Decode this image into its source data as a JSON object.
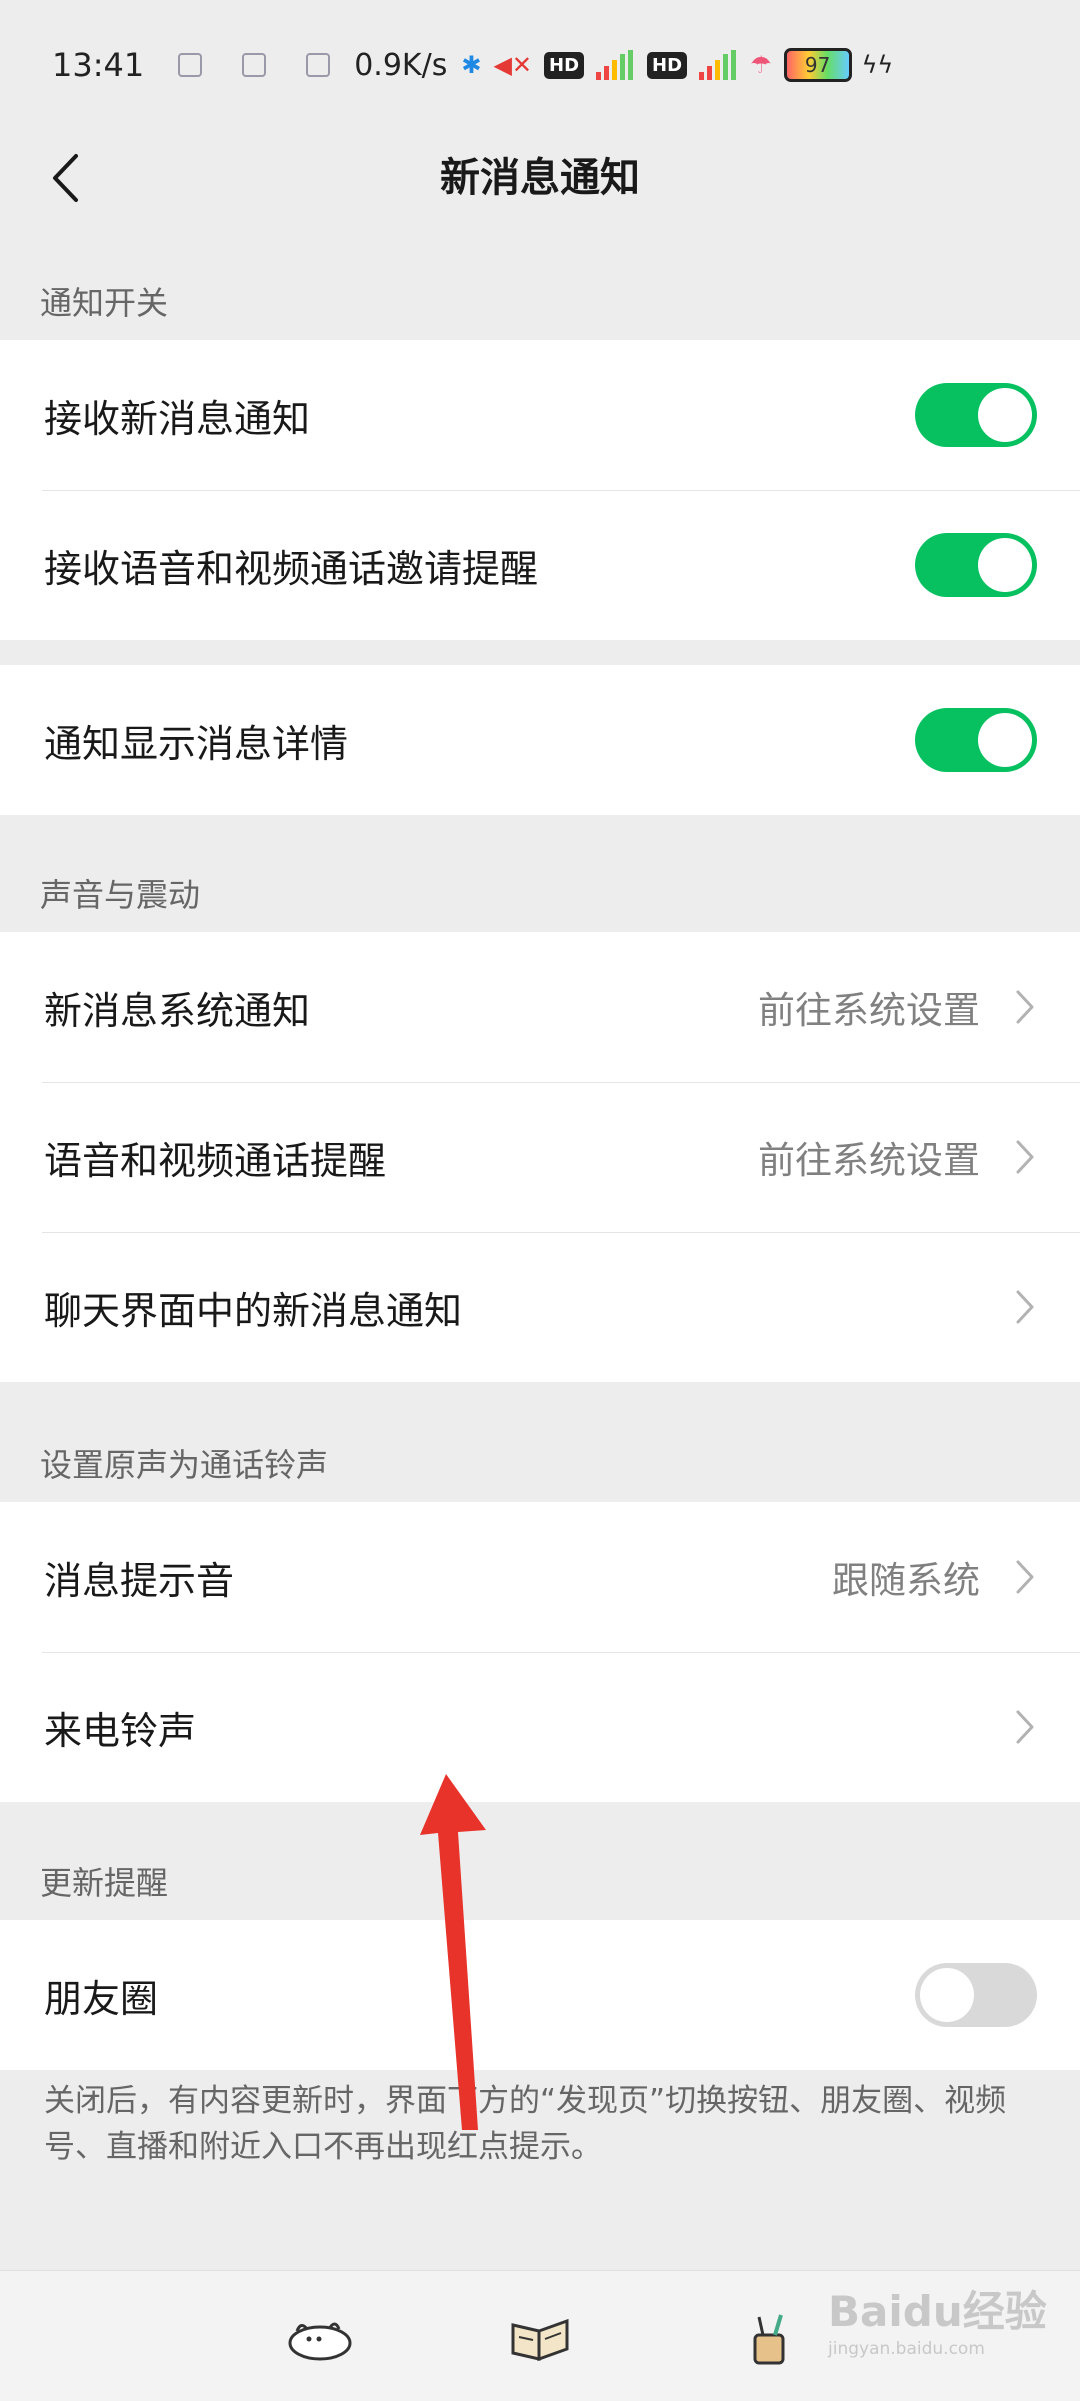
{
  "status_bar": {
    "time": "13:41",
    "net_speed": "0.9K/s",
    "hd1": "HD",
    "hd2": "HD",
    "battery": "97"
  },
  "header": {
    "title": "新消息通知"
  },
  "sections": {
    "notify_switch": "通知开关",
    "sound_vibration": "声音与震动",
    "ringtone_original": "设置原声为通话铃声",
    "update_reminder": "更新提醒"
  },
  "rows": {
    "receive_new_msg": {
      "label": "接收新消息通知",
      "toggle": true
    },
    "voice_video_invite": {
      "label": "接收语音和视频通话邀请提醒",
      "toggle": true
    },
    "show_details": {
      "label": "通知显示消息详情",
      "toggle": true
    },
    "system_notify": {
      "label": "新消息系统通知",
      "value": "前往系统设置"
    },
    "call_alert": {
      "label": "语音和视频通话提醒",
      "value": "前往系统设置"
    },
    "chat_notify": {
      "label": "聊天界面中的新消息通知"
    },
    "msg_tone": {
      "label": "消息提示音",
      "value": "跟随系统"
    },
    "ringtone": {
      "label": "来电铃声"
    },
    "moments": {
      "label": "朋友圈",
      "toggle": false
    }
  },
  "footnote": "关闭后，有内容更新时，界面下方的“发现页”切换按钮、朋友圈、视频号、直播和附近入口不再出现红点提示。",
  "watermark": {
    "text": "Baidu经验",
    "url": "jingyan.baidu.com"
  },
  "colors": {
    "accent": "#07c160",
    "annotation_arrow": "#e8332a"
  }
}
